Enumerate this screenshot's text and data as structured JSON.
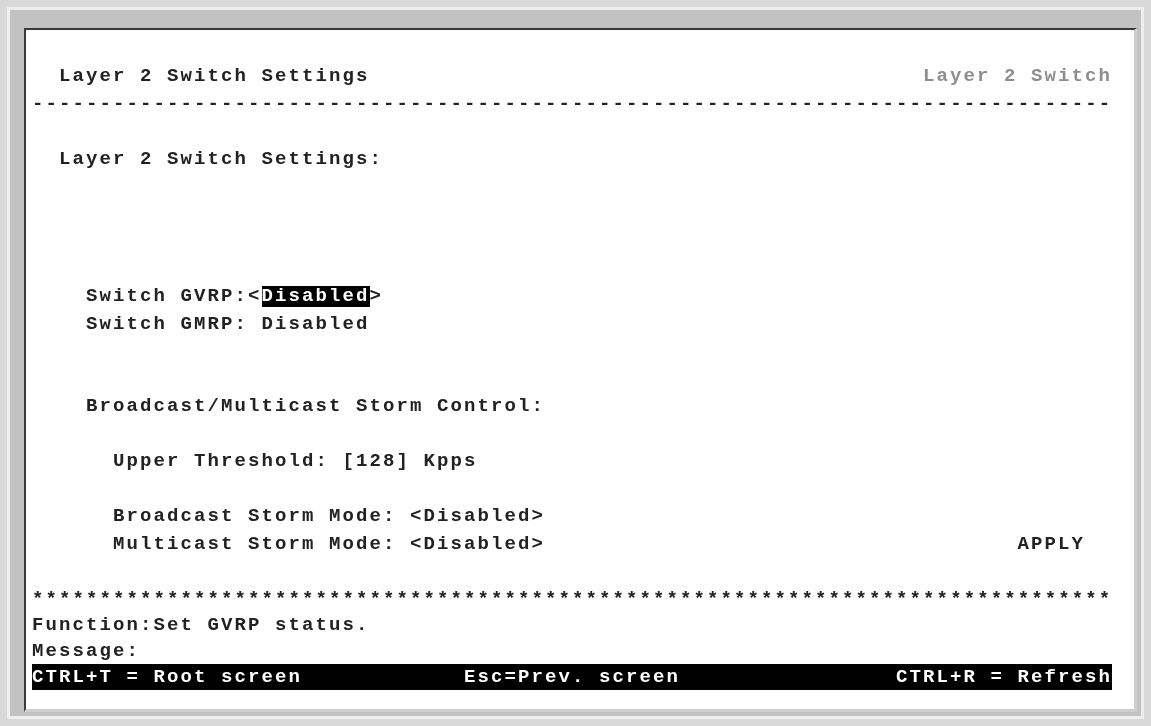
{
  "header": {
    "title": "Layer 2 Switch Settings",
    "location": "Layer 2 Switch"
  },
  "header_rule": "--------------------------------------------------------------------------------",
  "section_title": "Layer 2 Switch Settings:",
  "switch_settings": [
    {
      "kind": "option",
      "label": "Switch GVRP:",
      "open": "<",
      "value": "Disabled",
      "close": ">",
      "selected": true
    },
    {
      "kind": "readonly",
      "label": "Switch GMRP:",
      "value": "Disabled",
      "selected": false
    }
  ],
  "storm_control": {
    "title": "Broadcast/Multicast Storm Control:",
    "fields": [
      {
        "label": "Upper Threshold:",
        "open": "[",
        "value": "128",
        "close": "]",
        "unit": "Kpps",
        "selected": false
      },
      {
        "label": "Broadcast Storm Mode:",
        "open": "<",
        "value": "Disabled",
        "close": ">",
        "selected": false
      },
      {
        "label": "Multicast Storm Mode:",
        "open": "<",
        "value": "Disabled",
        "close": ">",
        "selected": false
      }
    ]
  },
  "apply_button": {
    "label": "APPLY",
    "selected": false
  },
  "footer_rule": "********************************************************************************",
  "function": {
    "label": "Function:",
    "text": "Set GVRP status."
  },
  "message": {
    "label": "Message:"
  },
  "shortcuts": [
    "CTRL+T = Root screen",
    "Esc=Prev. screen",
    "CTRL+R = Refresh"
  ]
}
